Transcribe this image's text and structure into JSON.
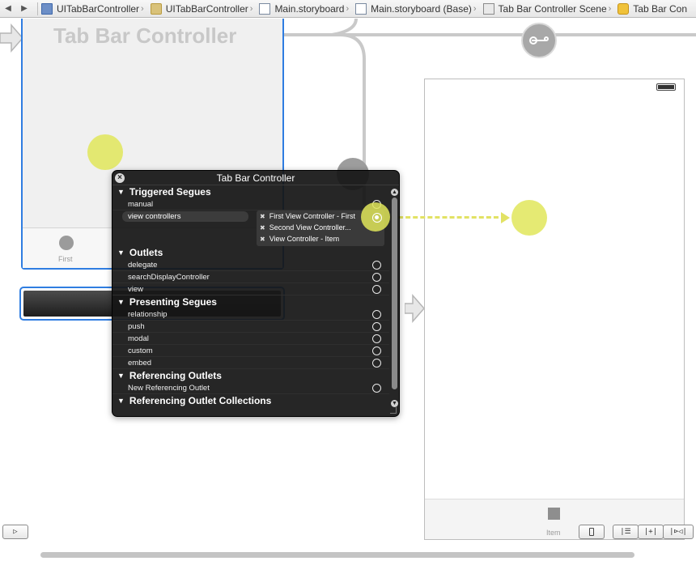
{
  "breadcrumbs": {
    "back_icon": "◀",
    "forward_icon": "▶",
    "items": [
      {
        "label": "UITabBarController",
        "icon": "project-icon"
      },
      {
        "label": "UITabBarController",
        "icon": "folder-icon"
      },
      {
        "label": "Main.storyboard",
        "icon": "storyboard-file-icon"
      },
      {
        "label": "Main.storyboard (Base)",
        "icon": "storyboard-file-icon"
      },
      {
        "label": "Tab Bar Controller Scene",
        "icon": "scene-icon"
      },
      {
        "label": "Tab Bar Con",
        "icon": "tab-bar-controller-icon"
      }
    ],
    "chevron": "›"
  },
  "canvas": {
    "tab_bar_controller_title": "Tab Bar Controller",
    "tab_bar_item_label": "First",
    "view_controller_tab_label": "Item"
  },
  "hud": {
    "title": "Tab Bar Controller",
    "close_glyph": "×",
    "triangle": "▼",
    "sections": {
      "triggered_segues": {
        "title": "Triggered Segues",
        "manual": "manual",
        "view_controllers": "view controllers",
        "connections": [
          "First View Controller - First",
          "Second View Controller...",
          "View Controller - Item"
        ],
        "connection_remove_glyph": "✖"
      },
      "outlets": {
        "title": "Outlets",
        "rows": [
          "delegate",
          "searchDisplayController",
          "view"
        ]
      },
      "presenting_segues": {
        "title": "Presenting Segues",
        "rows": [
          "relationship",
          "push",
          "modal",
          "custom",
          "embed"
        ]
      },
      "referencing_outlets": {
        "title": "Referencing Outlets",
        "rows": [
          "New Referencing Outlet"
        ]
      },
      "referencing_outlet_collections": {
        "title": "Referencing Outlet Collections"
      }
    },
    "scroll_up_glyph": "▲",
    "scroll_down_glyph": "▼"
  },
  "bottom_bar": {
    "buttons": [
      {
        "name": "show-document-outline-icon",
        "glyph": "▷"
      },
      {
        "name": "device-form-factor-icon",
        "glyph": ""
      },
      {
        "name": "align-icon",
        "glyph": "|☰"
      },
      {
        "name": "pin-icon",
        "glyph": "|+|"
      },
      {
        "name": "resolve-issues-icon",
        "glyph": "|⊳◁|"
      }
    ]
  },
  "colors": {
    "selection_blue": "#2f7de1",
    "connection_yellow": "#e2e264",
    "hud_background": "#161616"
  }
}
